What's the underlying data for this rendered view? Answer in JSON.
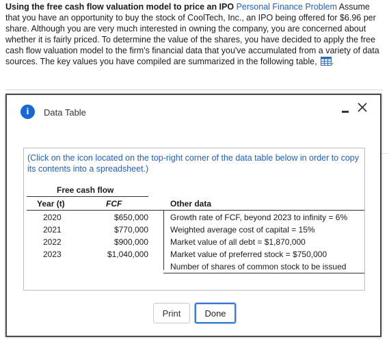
{
  "problem": {
    "title": "Using the free cash flow valuation model to price an IPO",
    "link": "Personal Finance Problem",
    "body": "Assume that you have an opportunity to buy the stock of CoolTech, Inc., an IPO being offered for $6.96 per share.  Although you are very much interested in owning the company, you are concerned about whether it is fairly priced.  To determine the value of the shares, you have decided to apply the free cash flow valuation model to the firm's financial data that you've accumulated from a variety of data sources.  The key values you have compiled are summarized in the following table,",
    "end": "."
  },
  "dialog": {
    "title": "Data Table",
    "note": "(Click on the icon located on the top-right corner of the data table below in order to copy its contents into a spreadsheet.)",
    "table": {
      "group_header": "Free cash flow",
      "col_year": "Year (t)",
      "col_fcf": "FCF",
      "col_other": "Other data",
      "rows": [
        {
          "year": "2020",
          "fcf": "$650,000",
          "other": "Growth rate of FCF, beyond 2023 to infinity = 6%"
        },
        {
          "year": "2021",
          "fcf": "$770,000",
          "other": "Weighted average cost of capital = 15%"
        },
        {
          "year": "2022",
          "fcf": "$900,000",
          "other": "Market value of all debt = $1,870,000"
        },
        {
          "year": "2023",
          "fcf": "$1,040,000",
          "other": "Market value of preferred stock = $750,000"
        }
      ],
      "extra_other": "Number of shares of common stock to be issued"
    },
    "buttons": {
      "print": "Print",
      "done": "Done"
    }
  }
}
